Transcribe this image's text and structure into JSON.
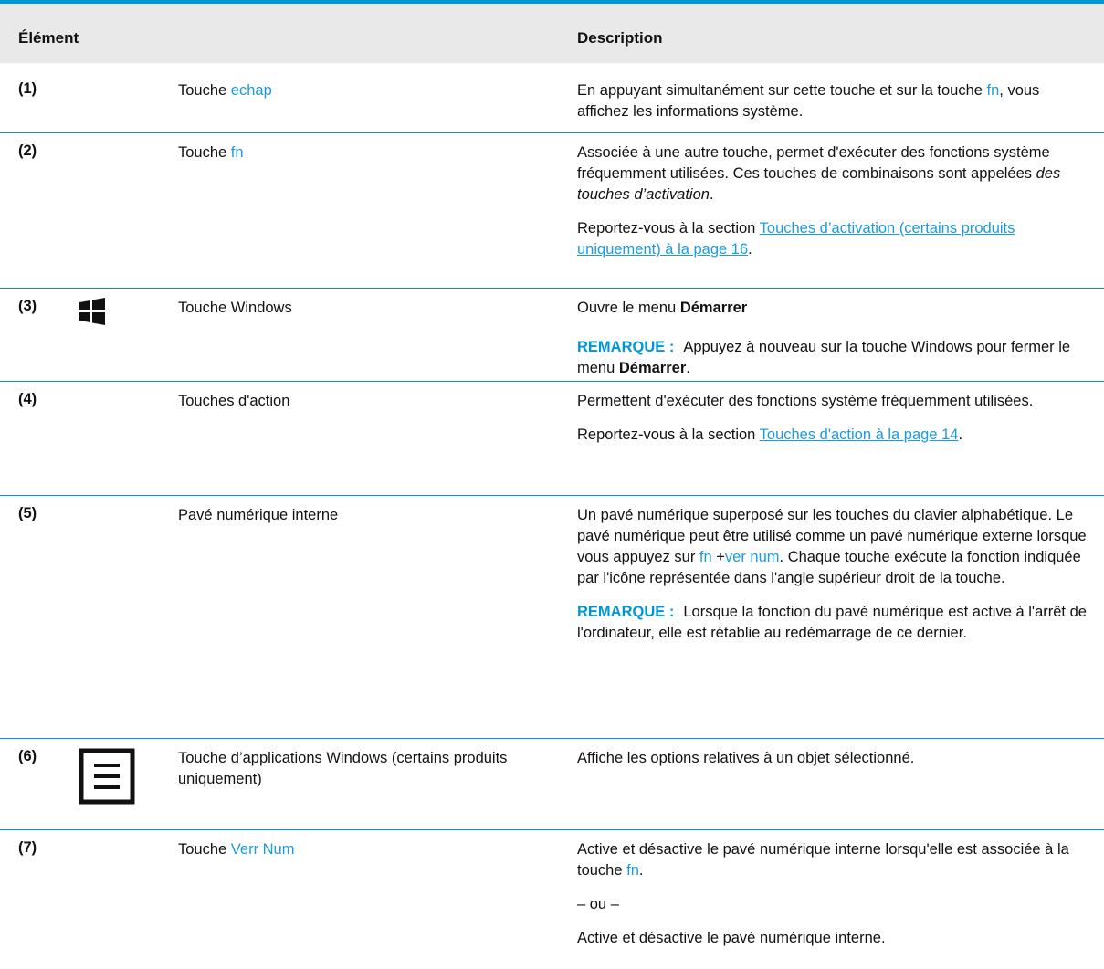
{
  "header": {
    "element": "Élément",
    "description": "Description"
  },
  "rows": [
    {
      "num": "(1)",
      "name_pre": "Touche ",
      "name_key": "echap",
      "desc_a": "En appuyant simultanément sur cette touche et sur la touche ",
      "desc_key": "fn",
      "desc_b": ", vous affichez les informations système."
    },
    {
      "num": "(2)",
      "name_pre": "Touche ",
      "name_key": "fn",
      "desc_a": "Associée à une autre touche, permet d'exécuter des fonctions système fréquemment utilisées. Ces touches de combinaisons sont appelées ",
      "desc_italic": "des touches d’activation",
      "desc_b": ".",
      "ref_pre": "Reportez-vous à la section ",
      "ref_link": "Touches d’activation (certains produits uniquement) à la page 16",
      "ref_post": "."
    },
    {
      "num": "(3)",
      "icon": "windows-logo-icon",
      "name": "Touche Windows",
      "desc_a": "Ouvre le menu ",
      "desc_bold": "Démarrer",
      "note_label": "REMARQUE :",
      "note_a": "Appuyez à nouveau sur la touche Windows pour fermer le menu ",
      "note_bold": "Démarrer",
      "note_b": "."
    },
    {
      "num": "(4)",
      "name": "Touches d'action",
      "desc": "Permettent d'exécuter des fonctions système fréquemment utilisées.",
      "ref_pre": "Reportez-vous à la section ",
      "ref_link": "Touches d'action à la page 14",
      "ref_post": "."
    },
    {
      "num": "(5)",
      "name": "Pavé numérique interne",
      "desc_a": "Un pavé numérique superposé sur les touches du clavier alphabétique. Le pavé numérique peut être utilisé comme un pavé numérique externe lorsque vous appuyez sur ",
      "desc_key1": "fn",
      "desc_plus": " +",
      "desc_key2": "ver num",
      "desc_b": ". Chaque touche exécute la fonction indiquée par l'icône représentée dans l'angle supérieur droit de la touche.",
      "note_label": "REMARQUE :",
      "note": "Lorsque la fonction du pavé numérique est active à l'arrêt de l'ordinateur, elle est rétablie au redémarrage de ce dernier."
    },
    {
      "num": "(6)",
      "icon": "application-menu-icon",
      "name": "Touche d’applications Windows (certains produits uniquement)",
      "desc": "Affiche les options relatives à un objet sélectionné."
    },
    {
      "num": "(7)",
      "name_pre": "Touche ",
      "name_key": "Verr Num",
      "desc_a": "Active et désactive le pavé numérique interne lorsqu'elle est associée à la touche ",
      "desc_key": "fn",
      "desc_b": ".",
      "or": "– ou –",
      "desc2": "Active et désactive le pavé numérique interne."
    }
  ]
}
